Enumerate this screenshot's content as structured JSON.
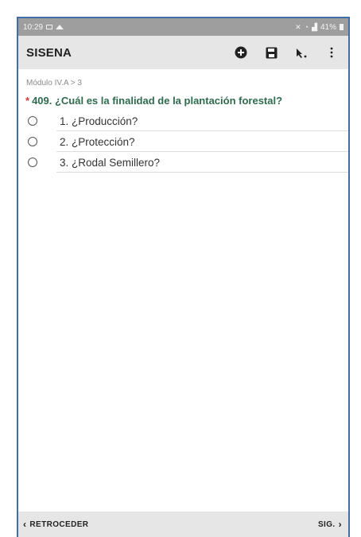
{
  "status": {
    "time": "10:29",
    "battery": "41%"
  },
  "appbar": {
    "title": "SISENA",
    "actions": [
      "add-circle-icon",
      "save-icon",
      "cursor-select-icon",
      "more-vert-icon"
    ]
  },
  "breadcrumb": "Módulo IV.A > 3",
  "question": {
    "required_mark": "*",
    "text": "409. ¿Cuál es la finalidad de la plantación forestal?"
  },
  "options": [
    {
      "label": "1. ¿Producción?"
    },
    {
      "label": "2. ¿Protección?"
    },
    {
      "label": "3. ¿Rodal Semillero?"
    }
  ],
  "navigation": {
    "back_label": "RETROCEDER",
    "next_label": "SIG."
  },
  "colors": {
    "question_text": "#2e6b4f",
    "required_mark": "#d23a3a",
    "bar_bg": "#e6e6e6",
    "status_bg": "#9e9e9e",
    "frame_border": "#3f6fa8"
  }
}
